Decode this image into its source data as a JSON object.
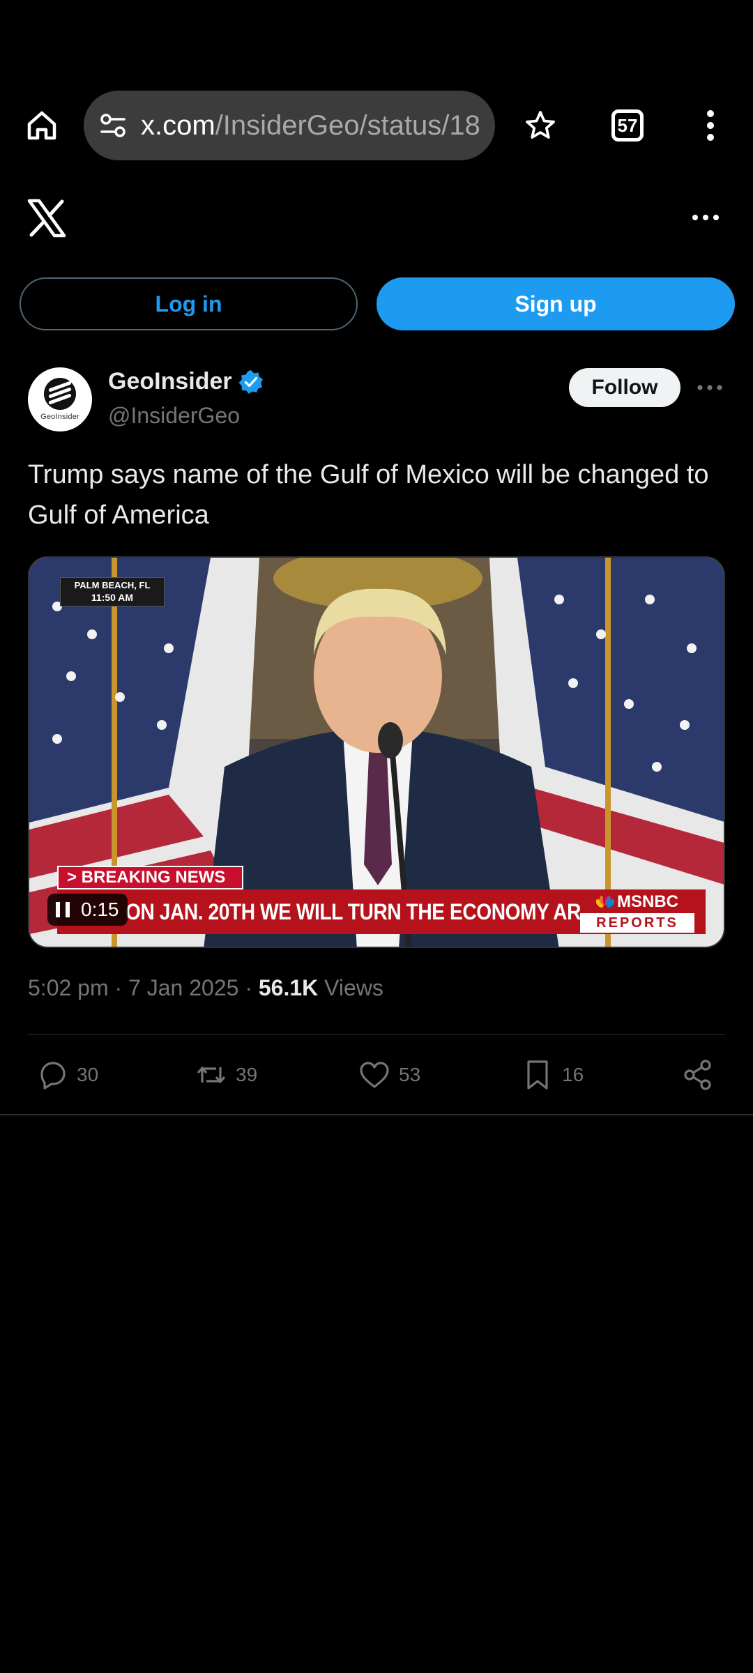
{
  "browser": {
    "url_host": "x.com",
    "url_path": "/InsiderGeo/status/18",
    "tab_count": "57",
    "icons": [
      "home-icon",
      "site-settings-icon",
      "bookmark-star-icon",
      "tab-switcher-icon",
      "overflow-menu-icon"
    ]
  },
  "header": {
    "logo": "x-logo-icon",
    "more_icon": "more-horizontal-icon"
  },
  "auth": {
    "login_label": "Log in",
    "signup_label": "Sign up"
  },
  "tweet": {
    "author": {
      "display_name": "GeoInsider",
      "handle": "@InsiderGeo",
      "avatar_caption": "GeoInsider",
      "verified": true
    },
    "follow_label": "Follow",
    "text": "Trump says name of the Gulf of Mexico will be changed to Gulf of America",
    "video": {
      "location": "PALM BEACH, FL",
      "clock": "11:50 AM",
      "breaking_label": "> BREAKING NEWS",
      "chyron": "ON JAN. 20TH WE WILL TURN THE ECONOMY AROUND",
      "network_name": "MSNBC",
      "network_sub": "REPORTS",
      "elapsed": "0:15"
    },
    "time": "5:02 pm",
    "date": "7 Jan 2025",
    "views_count": "56.1K",
    "views_label": "Views",
    "stats": {
      "replies": "30",
      "reposts": "39",
      "likes": "53",
      "bookmarks": "16"
    }
  },
  "colors": {
    "background": "#000000",
    "accent": "#1d9bf0",
    "secondary_text": "#71767b",
    "primary_text": "#e7e9ea"
  }
}
